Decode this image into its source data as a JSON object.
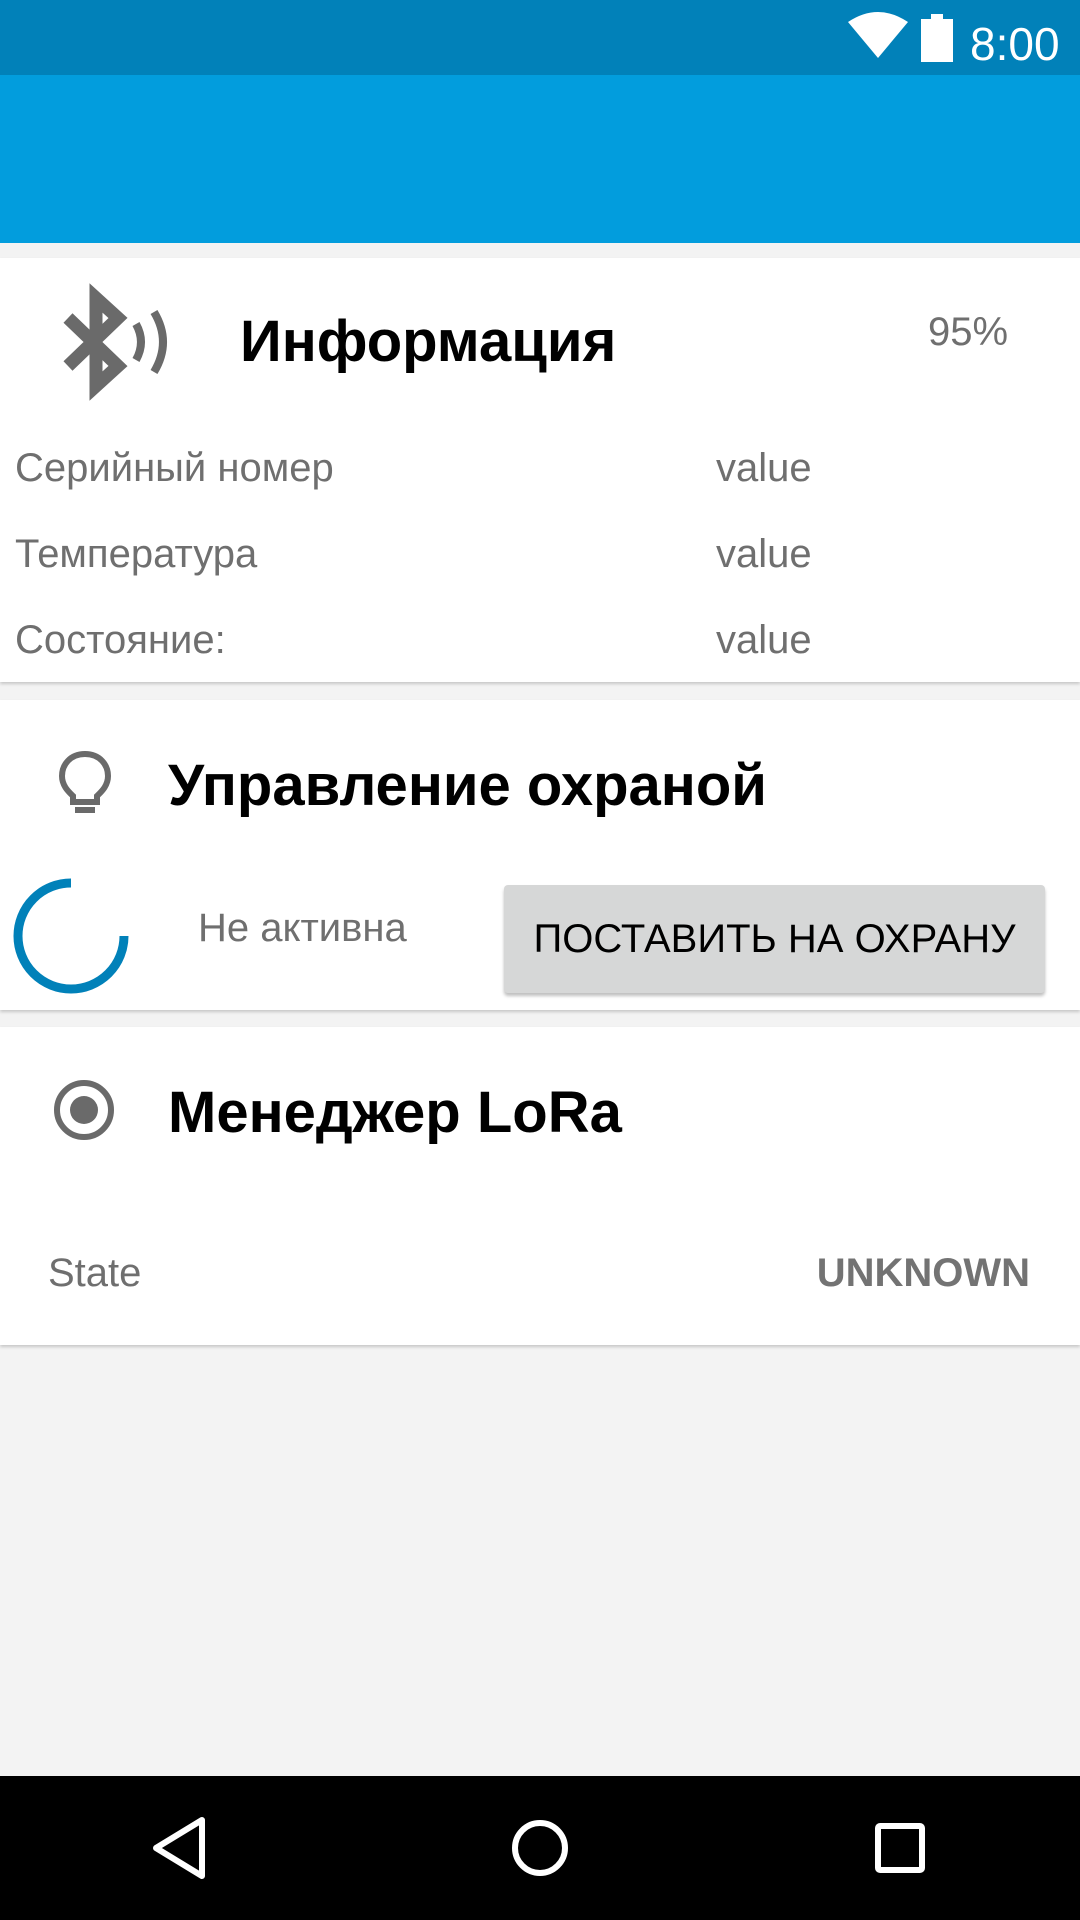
{
  "status_bar": {
    "time": "8:00",
    "icons": [
      "wifi-icon",
      "battery-icon"
    ],
    "background": "#0181b9"
  },
  "app_bar": {
    "background": "#029ddd"
  },
  "info_card": {
    "icon": "bluetooth-audio-icon",
    "title": "Информация",
    "percent": "95%",
    "rows": [
      {
        "label": "Серийный номер",
        "value": "value"
      },
      {
        "label": "Температура",
        "value": "value"
      },
      {
        "label": "Состояние:",
        "value": "value"
      }
    ]
  },
  "security_card": {
    "icon": "lightbulb-icon",
    "title": "Управление охраной",
    "spinner": "progress-spinner-icon",
    "status": "Не активна",
    "arm_button": "ПОСТАВИТЬ НА ОХРАНУ"
  },
  "lora_card": {
    "icon": "radio-button-icon",
    "title": "Менеджер LoRa",
    "state_label": "State",
    "state_value": "UNKNOWN"
  },
  "nav_bar": {
    "buttons": [
      "back-icon",
      "home-icon",
      "recents-icon"
    ]
  },
  "colors": {
    "accent": "#0181b9",
    "primary": "#029ddd",
    "background": "#f3f3f3"
  }
}
